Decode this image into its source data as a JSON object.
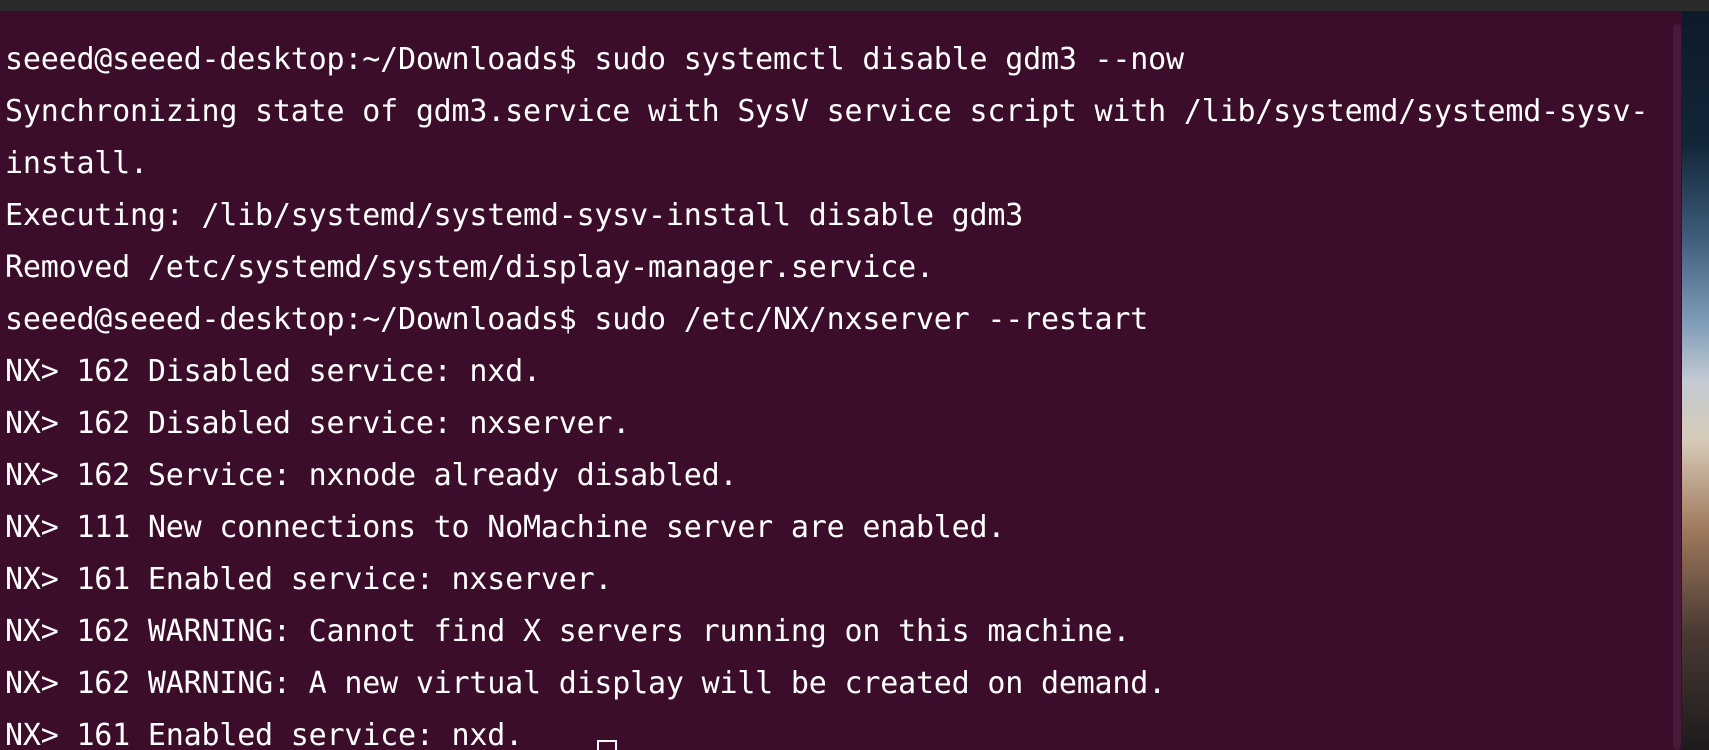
{
  "terminal": {
    "lines": [
      "seeed@seeed-desktop:~/Downloads$ sudo systemctl disable gdm3 --now",
      "Synchronizing state of gdm3.service with SysV service script with /lib/systemd/systemd-sysv-",
      "install.",
      "Executing: /lib/systemd/systemd-sysv-install disable gdm3",
      "Removed /etc/systemd/system/display-manager.service.",
      "seeed@seeed-desktop:~/Downloads$ sudo /etc/NX/nxserver --restart",
      "NX> 162 Disabled service: nxd.",
      "NX> 162 Disabled service: nxserver.",
      "NX> 162 Service: nxnode already disabled.",
      "NX> 111 New connections to NoMachine server are enabled.",
      "NX> 161 Enabled service: nxserver.",
      "NX> 162 WARNING: Cannot find X servers running on this machine.",
      "NX> 162 WARNING: A new virtual display will be created on demand.",
      "NX> 161 Enabled service: nxd."
    ],
    "colors": {
      "background": "#3b0d2a",
      "foreground": "#ffffff"
    }
  }
}
